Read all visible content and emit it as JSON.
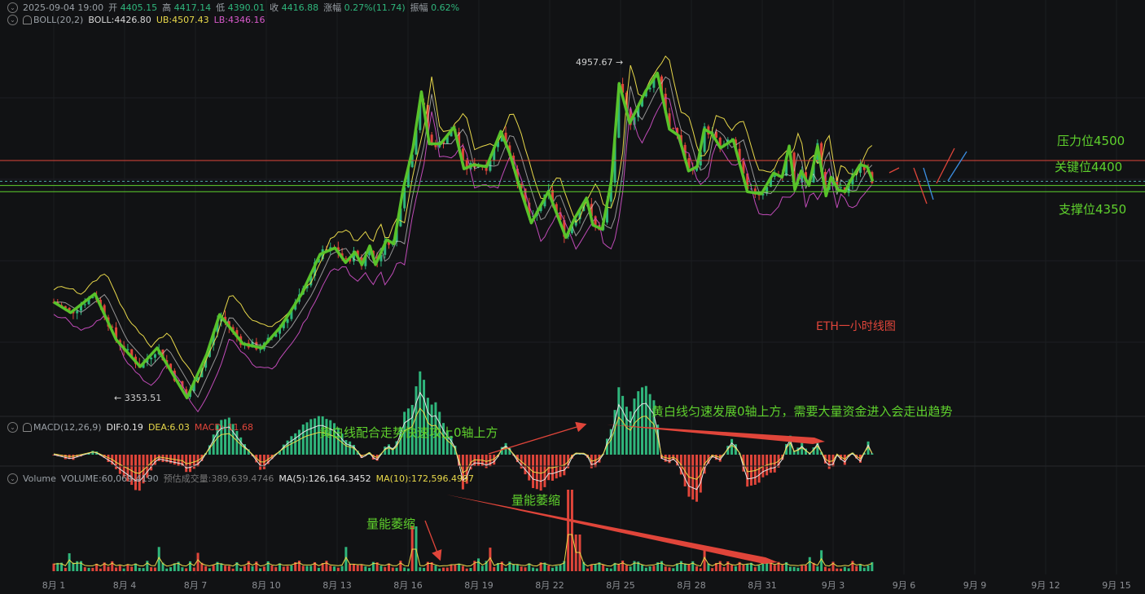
{
  "header": {
    "date": "2025-09-04 19:00",
    "open_label": "开",
    "open": "4405.15",
    "high_label": "高",
    "high": "4417.14",
    "low_label": "低",
    "low": "4390.01",
    "close_label": "收",
    "close": "4416.88",
    "change_label": "涨幅",
    "change": "0.27%(11.74)",
    "amp_label": "振幅",
    "amp": "0.62%"
  },
  "boll": {
    "name": "BOLL(20,2)",
    "mid": "BOLL:4426.80",
    "ub": "UB:4507.43",
    "lb": "LB:4346.16"
  },
  "macd": {
    "name": "MACD(12,26,9)",
    "dif": "DIF:0.19",
    "dea": "DEA:6.03",
    "macd": "MACD:-11.68"
  },
  "volume": {
    "name": "Volume",
    "vol": "VOLUME:60,069.4190",
    "est": "预估成交量:389,639.4746",
    "ma5": "MA(5):126,164.3452",
    "ma10": "MA(10):172,596.4997"
  },
  "levels": {
    "resistance": "压力位4500",
    "key": "关键位4400",
    "support": "支撑位4350"
  },
  "annotations": {
    "title": "ETH一小时线图",
    "macd_note_1": "黄白线配合走势快速攻上0轴上方",
    "macd_note_2": "黄白线匀速发展0轴上方，需要大量资金进入会走出趋势",
    "vol_note_1": "量能萎缩",
    "vol_note_2": "量能萎缩",
    "max_label": "4957.67",
    "min_label": "3353.51"
  },
  "colors": {
    "up": "#2fb67c",
    "down": "#e0453a",
    "zigzag": "#58c22a",
    "ub": "#e8d84a",
    "lb": "#c04bb8",
    "mid": "#cfcfcf",
    "resistance": "#e0453a",
    "support": "#5fd12d"
  },
  "chart_data": {
    "type": "line",
    "x_ticks": [
      "8月 1",
      "8月 4",
      "8月 7",
      "8月 10",
      "8月 13",
      "8月 16",
      "8月 19",
      "8月 22",
      "8月 25",
      "8月 28",
      "8月 31",
      "9月 3",
      "9月 6",
      "9月 9",
      "9月 12",
      "9月 15"
    ],
    "x_range": [
      0,
      15
    ],
    "ylim": [
      3300,
      5010
    ],
    "zigzag": {
      "x": [
        0,
        0.24,
        0.58,
        0.88,
        1.22,
        1.46,
        1.88,
        2.16,
        2.34,
        2.67,
        2.94,
        3.2,
        3.5,
        3.76,
        3.97,
        4.12,
        4.25,
        4.35,
        4.46,
        4.54,
        4.7,
        4.8,
        4.93,
        5.07,
        5.19,
        5.3,
        5.46,
        5.65,
        5.79,
        5.93,
        6.11,
        6.31,
        6.44,
        6.55,
        6.74,
        6.98,
        7.23,
        7.35,
        7.52,
        7.61,
        7.74,
        7.87,
        7.98,
        8.13,
        8.22,
        8.35,
        8.52,
        8.69,
        8.82,
        8.96,
        9.08,
        9.18,
        9.29,
        9.41,
        9.59,
        9.79,
        9.99,
        10.16,
        10.28,
        10.38,
        10.46,
        10.55,
        10.66,
        10.78,
        10.9,
        10.97,
        11.07,
        11.17,
        11.24,
        11.38,
        11.48,
        11.56
      ],
      "y": [
        3820,
        3770,
        3860,
        3640,
        3510,
        3600,
        3360,
        3570,
        3760,
        3620,
        3600,
        3700,
        3860,
        4050,
        4080,
        4010,
        4060,
        4000,
        4090,
        4000,
        4120,
        4100,
        4360,
        4560,
        4830,
        4580,
        4580,
        4660,
        4460,
        4480,
        4470,
        4640,
        4530,
        4400,
        4200,
        4350,
        4130,
        4220,
        4320,
        4190,
        4170,
        4400,
        4870,
        4680,
        4740,
        4830,
        4920,
        4650,
        4620,
        4450,
        4470,
        4650,
        4630,
        4560,
        4600,
        4350,
        4340,
        4440,
        4420,
        4570,
        4360,
        4450,
        4380,
        4570,
        4330,
        4420,
        4360,
        4350,
        4400,
        4480,
        4470,
        4400
      ]
    },
    "levels": [
      4500,
      4400,
      4350
    ]
  }
}
